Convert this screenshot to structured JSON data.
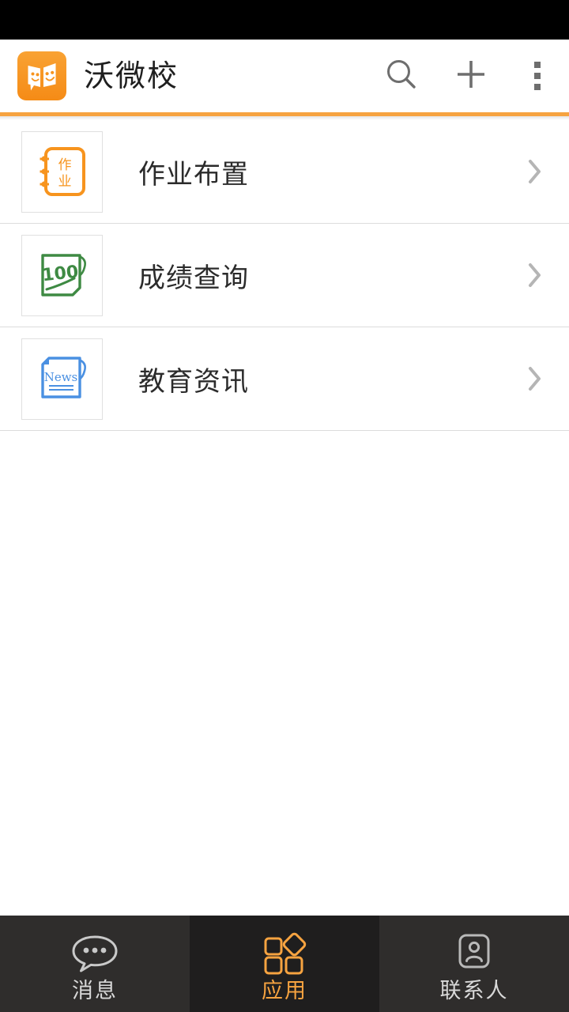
{
  "status_bar": {
    "background": "#000000"
  },
  "header": {
    "title": "沃微校",
    "logo_icon": "app-logo-two-faces-book",
    "logo_color": "#f7941e",
    "accent_rule_color": "#f6a340",
    "actions": [
      {
        "name": "search",
        "icon": "search-icon",
        "label": "搜索"
      },
      {
        "name": "add",
        "icon": "plus-icon",
        "label": "添加"
      },
      {
        "name": "more",
        "icon": "more-vertical-icon",
        "label": "更多"
      }
    ]
  },
  "app_list": {
    "items": [
      {
        "label": "作业布置",
        "icon": "notebook-homework-icon",
        "icon_color": "#f7941e",
        "icon_text": "作业",
        "chevron": "chevron-right-icon"
      },
      {
        "label": "成绩查询",
        "icon": "score-paper-100-icon",
        "icon_color": "#3e8a43",
        "icon_text": "100",
        "chevron": "chevron-right-icon"
      },
      {
        "label": "教育资讯",
        "icon": "news-paper-icon",
        "icon_color": "#4a90e2",
        "icon_text": "News",
        "chevron": "chevron-right-icon"
      }
    ]
  },
  "tab_bar": {
    "active_color": "#f6a340",
    "inactive_color": "#d9d9d9",
    "tabs": [
      {
        "label": "消息",
        "icon": "chat-bubble-icon",
        "active": false
      },
      {
        "label": "应用",
        "icon": "apps-grid-icon",
        "active": true
      },
      {
        "label": "联系人",
        "icon": "contacts-person-icon",
        "active": false
      }
    ]
  }
}
